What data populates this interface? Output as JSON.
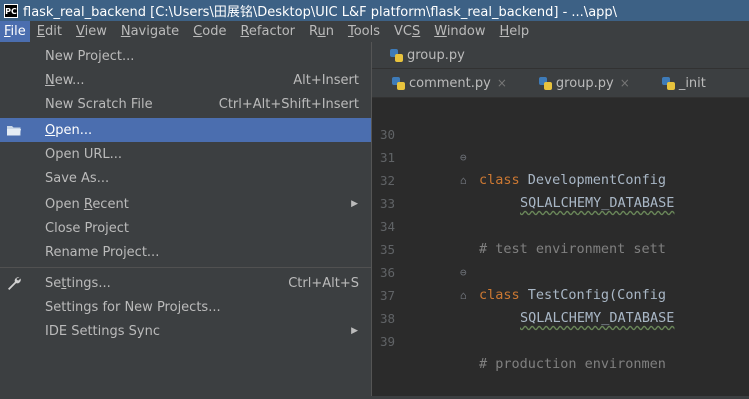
{
  "window": {
    "title": "flask_real_backend [C:\\Users\\田展铭\\Desktop\\UIC L&F platform\\flask_real_backend] - ...\\app\\",
    "logo_text": "PC"
  },
  "menubar": {
    "items": [
      {
        "pre": "",
        "u": "F",
        "post": "ile"
      },
      {
        "pre": "",
        "u": "E",
        "post": "dit"
      },
      {
        "pre": "",
        "u": "V",
        "post": "iew"
      },
      {
        "pre": "",
        "u": "N",
        "post": "avigate"
      },
      {
        "pre": "",
        "u": "C",
        "post": "ode"
      },
      {
        "pre": "",
        "u": "R",
        "post": "efactor"
      },
      {
        "pre": "R",
        "u": "u",
        "post": "n"
      },
      {
        "pre": "",
        "u": "T",
        "post": "ools"
      },
      {
        "pre": "VC",
        "u": "S",
        "post": ""
      },
      {
        "pre": "",
        "u": "W",
        "post": "indow"
      },
      {
        "pre": "",
        "u": "H",
        "post": "elp"
      }
    ]
  },
  "file_menu": {
    "items": [
      {
        "pre": "New Project...",
        "u": "",
        "post": "",
        "shortcut": ""
      },
      {
        "pre": "",
        "u": "N",
        "post": "ew...",
        "shortcut": "Alt+Insert"
      },
      {
        "pre": "New Scratch File",
        "u": "",
        "post": "",
        "shortcut": "Ctrl+Alt+Shift+Insert"
      },
      {
        "pre": "",
        "u": "O",
        "post": "pen...",
        "shortcut": ""
      },
      {
        "pre": "Open URL...",
        "u": "",
        "post": "",
        "shortcut": ""
      },
      {
        "pre": "Save As...",
        "u": "",
        "post": "",
        "shortcut": ""
      },
      {
        "pre": "Open ",
        "u": "R",
        "post": "ecent",
        "shortcut": ""
      },
      {
        "pre": "Close Project",
        "u": "",
        "post": "",
        "shortcut": ""
      },
      {
        "pre": "Rename Project...",
        "u": "",
        "post": "",
        "shortcut": ""
      },
      {
        "pre": "Se",
        "u": "t",
        "post": "tings...",
        "shortcut": "Ctrl+Alt+S"
      },
      {
        "pre": "Settings for New Projects...",
        "u": "",
        "post": "",
        "shortcut": ""
      },
      {
        "pre": "IDE Settings Sync",
        "u": "",
        "post": "",
        "shortcut": ""
      }
    ]
  },
  "editor": {
    "breadcrumb": "group.py",
    "tabs": [
      "comment.py",
      "group.py",
      "_init"
    ],
    "active_tab": 1,
    "tab_close": "×",
    "lines": [
      {
        "num": "30",
        "kw": "class ",
        "text": "DevelopmentConfig",
        "cm": ""
      },
      {
        "num": "31",
        "kw": "",
        "text": "SQLALCHEMY_DATABASE",
        "cm": ""
      },
      {
        "num": "32",
        "kw": "",
        "text": "",
        "cm": ""
      },
      {
        "num": "33",
        "kw": "",
        "text": "",
        "cm": ""
      },
      {
        "num": "34",
        "kw": "",
        "text": "",
        "cm": "# test environment sett"
      },
      {
        "num": "35",
        "kw": "class ",
        "text": "TestConfig(Config",
        "cm": ""
      },
      {
        "num": "36",
        "kw": "",
        "text": "SQLALCHEMY_DATABASE",
        "cm": ""
      },
      {
        "num": "37",
        "kw": "",
        "text": "",
        "cm": ""
      },
      {
        "num": "38",
        "kw": "",
        "text": "",
        "cm": ""
      },
      {
        "num": "39",
        "kw": "",
        "text": "",
        "cm": "# production environmen"
      }
    ]
  },
  "colors": {
    "title_bar": "#3d6185",
    "menu_highlight": "#4b6eaf",
    "editor_bg": "#2b2b2b",
    "panel_bg": "#3c3f41",
    "keyword": "#cc7832",
    "comment": "#808080"
  },
  "icons": {
    "open": "folder-icon",
    "settings": "wrench-icon",
    "submenu": "arrow-right-icon",
    "file": "python-file-icon"
  }
}
